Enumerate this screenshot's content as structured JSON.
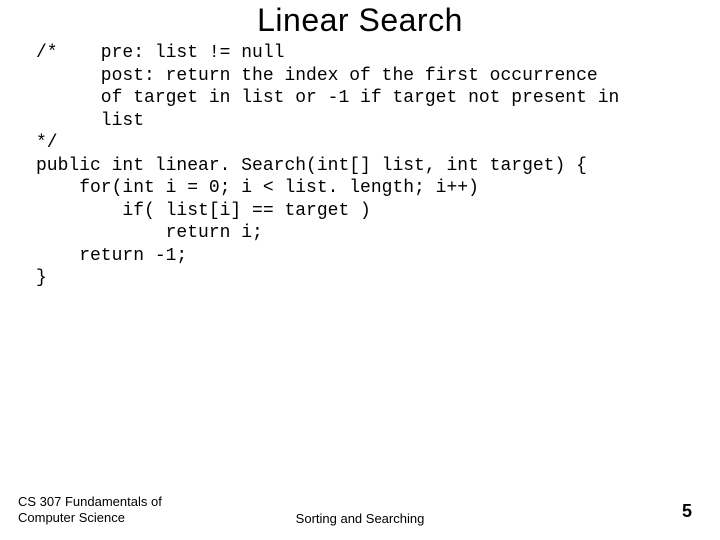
{
  "title": "Linear Search",
  "code": "/*    pre: list != null\n      post: return the index of the first occurrence\n      of target in list or -1 if target not present in\n      list\n*/\npublic int linear. Search(int[] list, int target) {\n    for(int i = 0; i < list. length; i++)\n        if( list[i] == target )\n            return i;\n    return -1;\n}",
  "footer": {
    "left": "CS 307 Fundamentals of\nComputer Science",
    "center": "Sorting and Searching",
    "page": "5"
  }
}
